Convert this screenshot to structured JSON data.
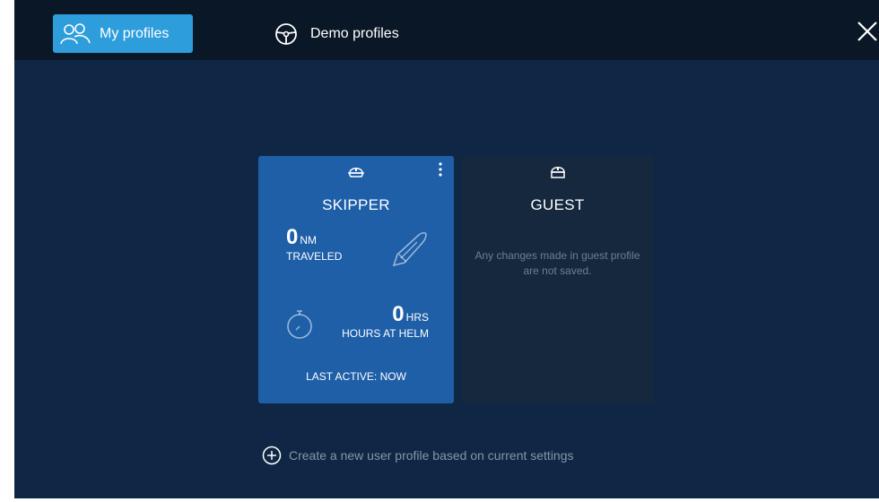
{
  "tabs": [
    {
      "label": "My profiles",
      "icon": "users-icon",
      "active": true
    },
    {
      "label": "Demo profiles",
      "icon": "steering-wheel-icon",
      "active": false
    }
  ],
  "close_icon": "close-icon",
  "profiles": {
    "skipper": {
      "name": "SKIPPER",
      "distance_value": "0",
      "distance_unit": "NM",
      "distance_label": "TRAVELED",
      "hours_value": "0",
      "hours_unit": "HRS",
      "hours_label": "HOURS AT HELM",
      "last_active": "LAST ACTIVE: NOW",
      "color": "#1e5fa8"
    },
    "guest": {
      "name": "GUEST",
      "note": "Any changes made in guest profile are not saved.",
      "color": "#15283e"
    }
  },
  "create_profile_label": "Create a new user profile based on current settings",
  "colors": {
    "background": "#0f2744",
    "topbar": "#0a1726",
    "accent": "#2e9ddc"
  }
}
